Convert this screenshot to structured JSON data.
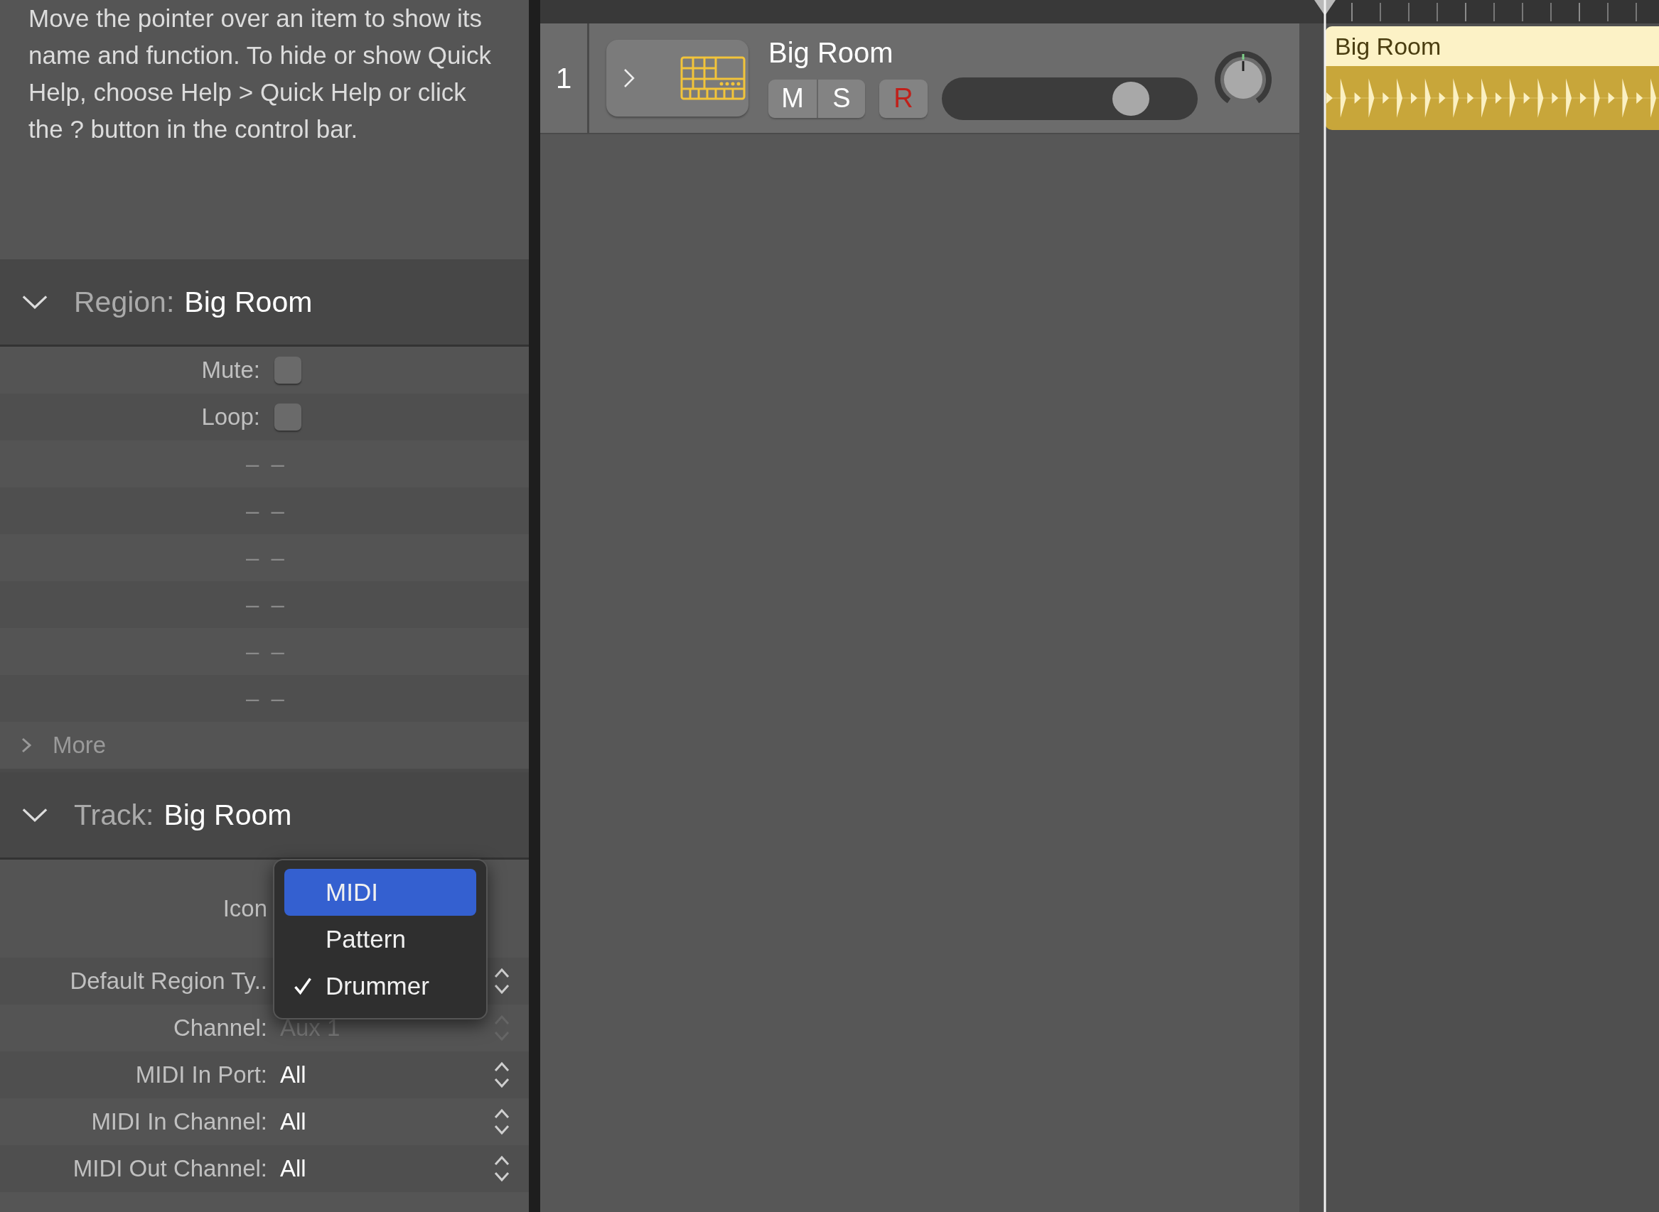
{
  "quick_help": {
    "text": "Move the pointer over an item to show its name and function. To hide or show Quick Help, choose Help > Quick Help or click the ? button in the control bar."
  },
  "region_inspector": {
    "label": "Region:",
    "name": "Big Room",
    "expanded": true,
    "rows": [
      {
        "kind": "checkbox",
        "label": "Mute:",
        "checked": false
      },
      {
        "kind": "checkbox",
        "label": "Loop:",
        "checked": false
      },
      {
        "kind": "empty",
        "value": "– –"
      },
      {
        "kind": "empty",
        "value": "– –"
      },
      {
        "kind": "empty",
        "value": "– –"
      },
      {
        "kind": "empty",
        "value": "– –"
      },
      {
        "kind": "empty",
        "value": "– –"
      },
      {
        "kind": "empty",
        "value": "– –"
      }
    ],
    "more": {
      "label": "More",
      "expanded": false
    }
  },
  "track_inspector": {
    "label": "Track:",
    "name": "Big Room",
    "expanded": true,
    "rows": [
      {
        "kind": "icon",
        "label": "Icon"
      },
      {
        "kind": "popup",
        "label": "Default Region Ty.."
      },
      {
        "kind": "popup",
        "label": "Channel:",
        "value": "Aux 1",
        "disabled": true
      },
      {
        "kind": "popup",
        "label": "MIDI In Port:",
        "value": "All",
        "disabled": false
      },
      {
        "kind": "popup",
        "label": "MIDI In Channel:",
        "value": "All",
        "disabled": false
      },
      {
        "kind": "popup",
        "label": "MIDI Out Channel:",
        "value": "All",
        "disabled": false
      }
    ]
  },
  "popup_menu": {
    "items": [
      {
        "label": "MIDI",
        "selected": true,
        "checked": false
      },
      {
        "label": "Pattern",
        "selected": false,
        "checked": false
      },
      {
        "label": "Drummer",
        "selected": false,
        "checked": true
      }
    ]
  },
  "tracks": [
    {
      "number": "1",
      "name": "Big Room",
      "expanded": false,
      "mute": {
        "label": "M",
        "on": false
      },
      "solo": {
        "label": "S",
        "on": false
      },
      "record": {
        "label": "R",
        "on": false
      },
      "level": 0.74
    }
  ],
  "regions": [
    {
      "name": "Big Room"
    }
  ]
}
